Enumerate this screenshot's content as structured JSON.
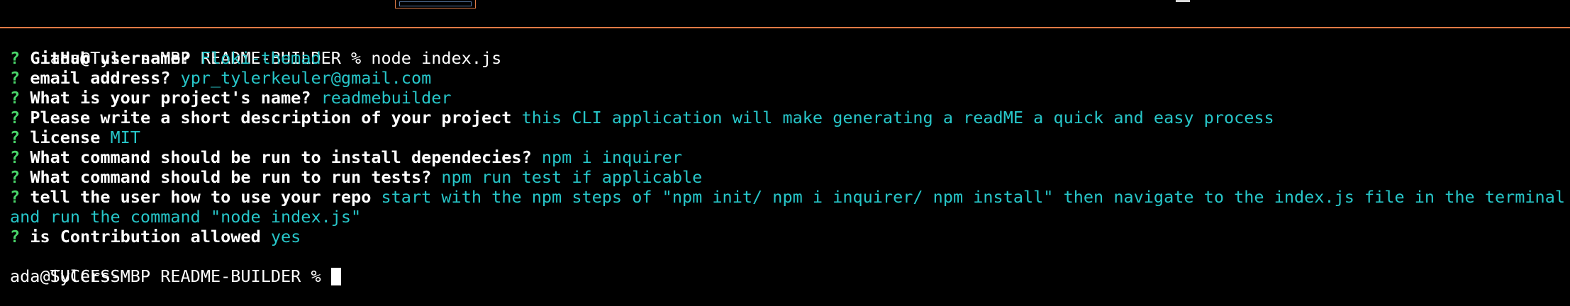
{
  "terminal": {
    "command_line": "ada@Tylers-MBP README-BUILDER % node index.js",
    "question_marker": "?",
    "prompts": [
      {
        "label": "GitHub username?",
        "answer": "Floki-themad"
      },
      {
        "label": "email address?",
        "answer": "ypr_tylerkeuler@gmail.com"
      },
      {
        "label": "What is your project's name?",
        "answer": "readmebuilder"
      },
      {
        "label": "Please write a short description of your project",
        "answer": "this CLI application will make generating a readME a quick and easy process"
      },
      {
        "label": "license",
        "answer": "MIT"
      },
      {
        "label": "What command should be run to install dependecies?",
        "answer": "npm i inquirer"
      },
      {
        "label": "What command should be run to run tests?",
        "answer": "npm run test if applicable"
      },
      {
        "label": "tell the user how to use your repo",
        "answer": "start with the npm steps of \"npm init/ npm i inquirer/ npm install\" then navigate to the index.js file in the terminal",
        "answer_continued": "and run the command \"node index.js\""
      },
      {
        "label": "is Contribution allowed",
        "answer": "yes"
      }
    ],
    "status": "SUCCESS",
    "final_prompt": "ada@Tylers-MBP README-BUILDER % "
  },
  "colors": {
    "background": "#000000",
    "question_mark": "#49d66a",
    "answer": "#27c6c9",
    "text": "#ffffff"
  }
}
